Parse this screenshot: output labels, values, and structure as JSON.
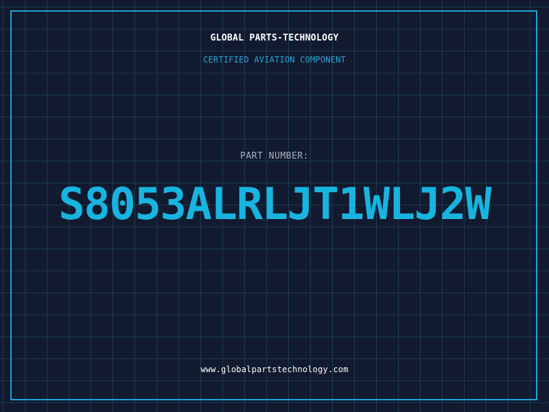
{
  "header": {
    "company": "GLOBAL PARTS-TECHNOLOGY",
    "subtitle": "CERTIFIED AVIATION COMPONENT"
  },
  "part": {
    "label": "PART NUMBER:",
    "number": "S8053ALRLJT1WLJ2W"
  },
  "footer": {
    "website": "www.globalpartstechnology.com"
  },
  "colors": {
    "background": "#111a2e",
    "grid": "#1a3a55",
    "accent": "#18b4e0",
    "frame": "#1aa6d6"
  }
}
